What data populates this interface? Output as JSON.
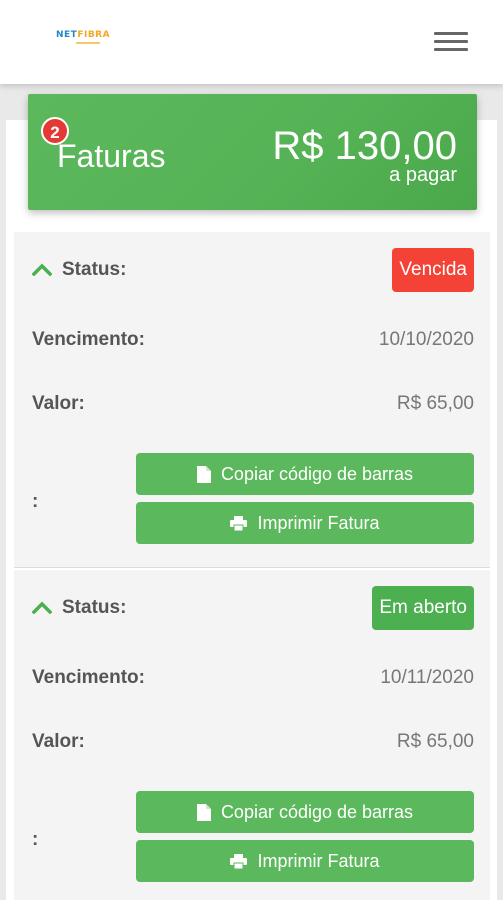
{
  "header": {
    "logo_part1": "NET",
    "logo_part2": "FIBRA",
    "menu_icon": "hamburger-menu-icon"
  },
  "summary": {
    "badge_count": "2",
    "title": "Faturas",
    "total": "R$ 130,00",
    "total_caption": "a pagar"
  },
  "labels": {
    "status": "Status:",
    "due": "Vencimento:",
    "value": "Valor:",
    "extra": ":",
    "copy_button": "Copiar código de barras",
    "print_button": "Imprimir Fatura"
  },
  "invoices": [
    {
      "status": "Vencida",
      "status_color": "#f44336",
      "due_date": "10/10/2020",
      "amount": "R$ 65,00"
    },
    {
      "status": "Em aberto",
      "status_color": "#4caf50",
      "due_date": "10/11/2020",
      "amount": "R$ 65,00"
    }
  ],
  "colors": {
    "accent_green": "#5cb85c",
    "badge_red": "#e53935"
  }
}
